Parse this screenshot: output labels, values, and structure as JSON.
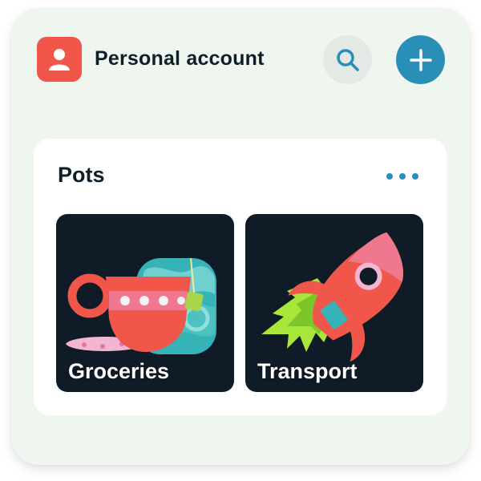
{
  "header": {
    "account_name": "Personal account",
    "avatar_icon": "user-icon",
    "search_icon": "search-icon",
    "add_icon": "plus-icon"
  },
  "pots": {
    "title": "Pots",
    "more_icon": "more-icon",
    "items": [
      {
        "label": "Groceries",
        "illustration": "teacup-illustration"
      },
      {
        "label": "Transport",
        "illustration": "rocket-illustration"
      }
    ]
  },
  "colors": {
    "background": "#eef6ef",
    "accent": "#2a8fb6",
    "avatar": "#f0564a",
    "tile": "#0f1b26",
    "text": "#0f1f29"
  }
}
